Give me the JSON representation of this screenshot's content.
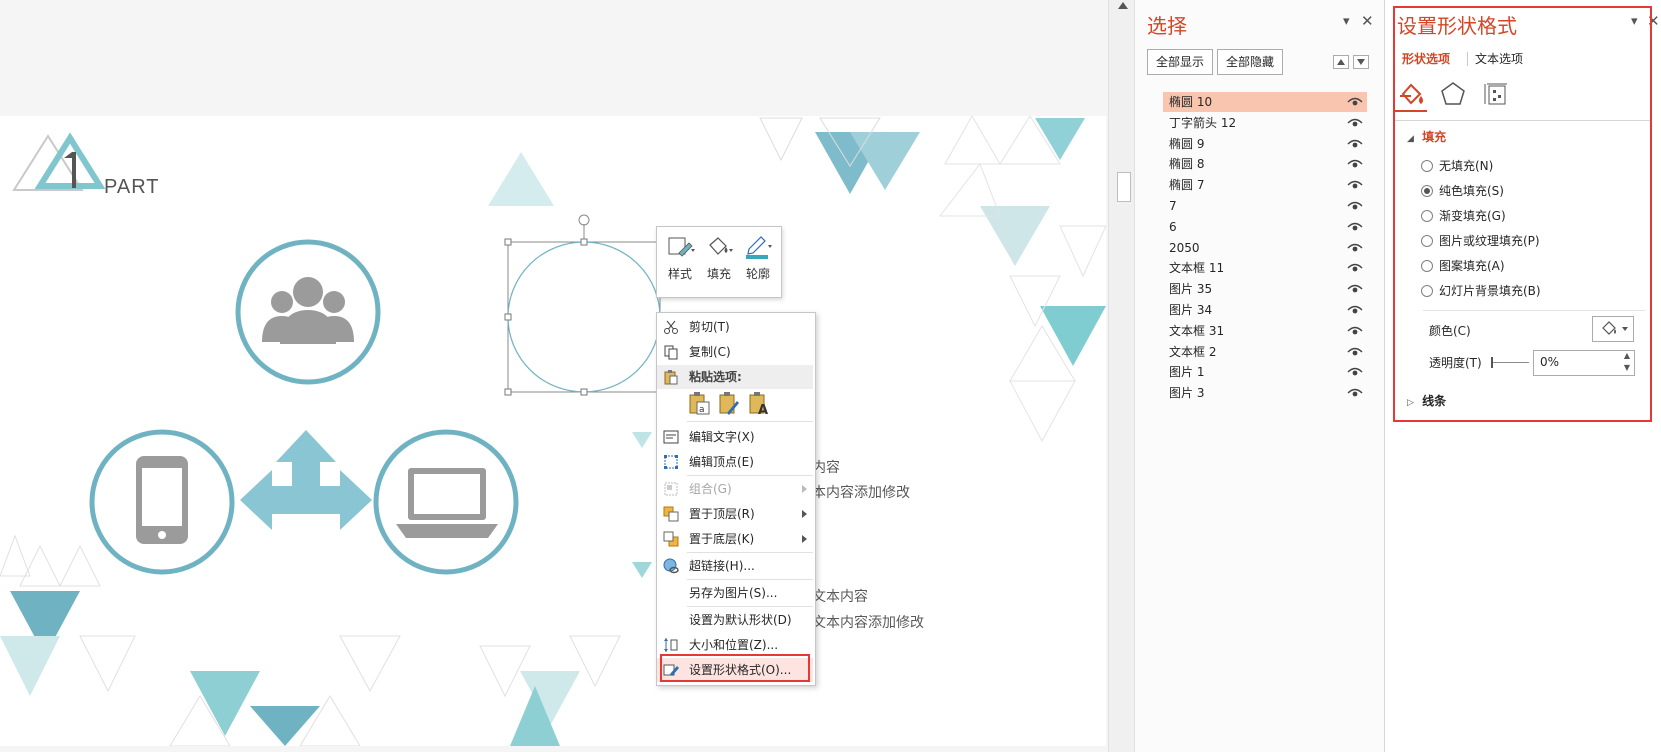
{
  "slide": {
    "part_number": "1",
    "part_label": "PART",
    "texts": [
      "内容",
      "本内容添加修改",
      "文本内容",
      "文本内容添加修改"
    ]
  },
  "mini_toolbar": {
    "buttons": [
      {
        "label": "样式",
        "icon": "shape-style-icon"
      },
      {
        "label": "填充",
        "icon": "paint-bucket-icon"
      },
      {
        "label": "轮廓",
        "icon": "pen-outline-icon"
      }
    ]
  },
  "context_menu": {
    "cut": "剪切(T)",
    "copy": "复制(C)",
    "paste_options": "粘贴选项:",
    "edit_text": "编辑文字(X)",
    "edit_points": "编辑顶点(E)",
    "group": "组合(G)",
    "bring_front": "置于顶层(R)",
    "send_back": "置于底层(K)",
    "hyperlink": "超链接(H)...",
    "save_as_picture": "另存为图片(S)...",
    "set_default_shape": "设置为默认形状(D)",
    "size_position": "大小和位置(Z)...",
    "format_shape": "设置形状格式(O)..."
  },
  "selection_pane": {
    "title": "选择",
    "show_all": "全部显示",
    "hide_all": "全部隐藏",
    "items": [
      "椭圆 10",
      "丁字箭头 12",
      "椭圆 9",
      "椭圆 8",
      "椭圆 7",
      "7",
      "6",
      "2050",
      "文本框 11",
      "图片 35",
      "图片 34",
      "文本框 31",
      "文本框 2",
      "图片 1",
      "图片 3"
    ],
    "selected_index": 0
  },
  "format_pane": {
    "title": "设置形状格式",
    "tab_shape": "形状选项",
    "tab_text": "文本选项",
    "fill_section": "填充",
    "fill_options": [
      "无填充(N)",
      "纯色填充(S)",
      "渐变填充(G)",
      "图片或纹理填充(P)",
      "图案填充(A)",
      "幻灯片背景填充(B)"
    ],
    "selected_fill": 1,
    "color_label": "颜色(C)",
    "transparency_label": "透明度(T)",
    "transparency_value": "0%",
    "line_section": "线条"
  },
  "colors": {
    "accent": "#d24726",
    "teal": "#6fb3c3",
    "highlight": "#e53935",
    "selected_row": "#f9c5ae",
    "icon_gray": "#9b9b9b"
  }
}
